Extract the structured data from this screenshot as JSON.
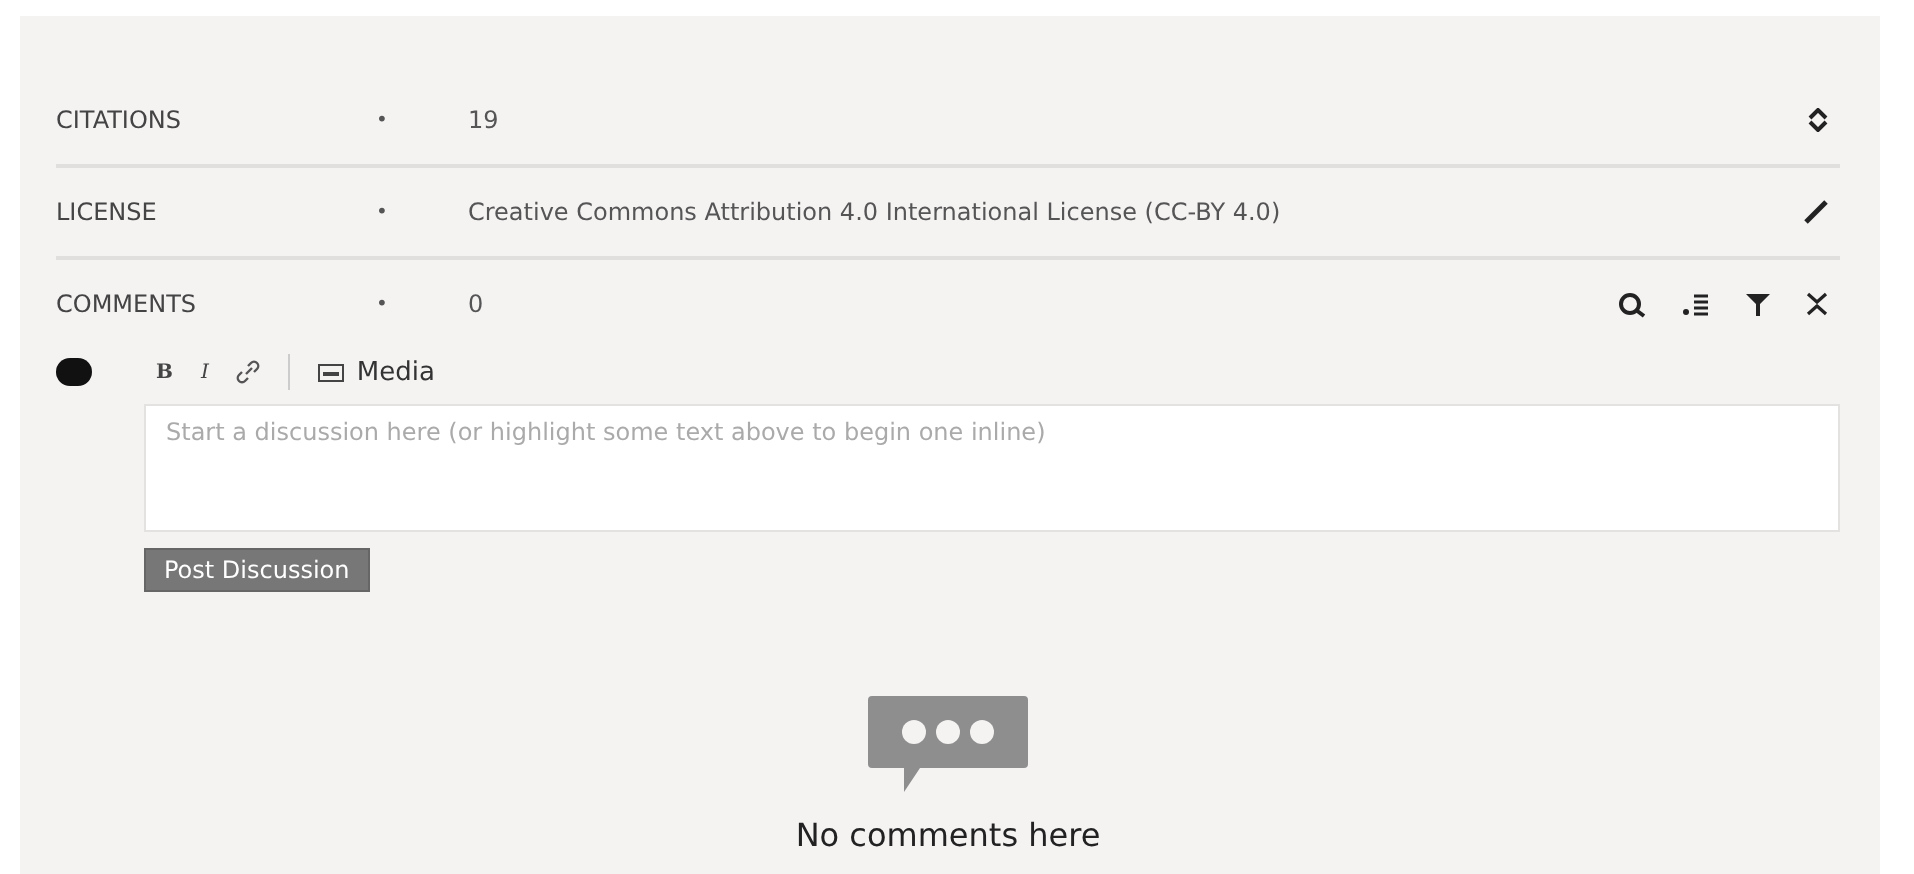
{
  "rows": [
    {
      "kind": "sortable",
      "label": "CITATIONS",
      "bullet": "•",
      "value": "19"
    },
    {
      "kind": "editable",
      "label": "LICENSE",
      "bullet": "•",
      "value": "Creative Commons Attribution 4.0 International License (CC-BY 4.0)"
    },
    {
      "kind": "tools",
      "label": "COMMENTS",
      "bullet": "•",
      "value": "0"
    }
  ],
  "editor": {
    "bold": "B",
    "italic": "I",
    "media": "Media",
    "placeholder": "Start a discussion here (or highlight some text above to begin one inline)",
    "submit": "Post Discussion"
  },
  "empty": {
    "message": "No comments here"
  }
}
